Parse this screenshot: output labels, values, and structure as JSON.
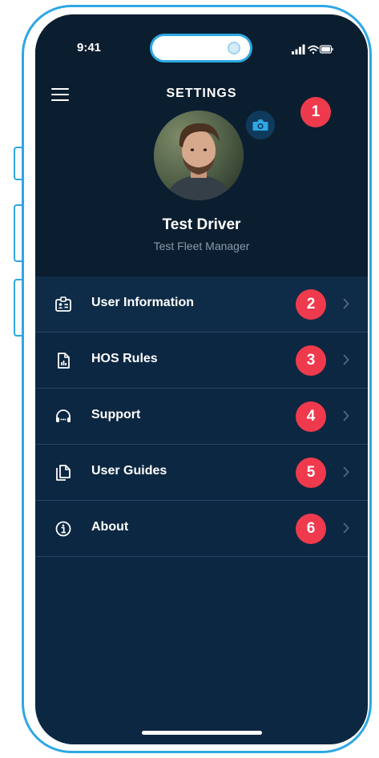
{
  "status_bar": {
    "time": "9:41"
  },
  "header": {
    "title": "SETTINGS"
  },
  "profile": {
    "name": "Test Driver",
    "role": "Test Fleet Manager",
    "badge": "1"
  },
  "menu": {
    "items": [
      {
        "label": "User Information",
        "badge": "2",
        "icon": "id-card-icon"
      },
      {
        "label": "HOS Rules",
        "badge": "3",
        "icon": "document-chart-icon"
      },
      {
        "label": "Support",
        "badge": "4",
        "icon": "headset-icon"
      },
      {
        "label": "User Guides",
        "badge": "5",
        "icon": "copy-document-icon"
      },
      {
        "label": "About",
        "badge": "6",
        "icon": "info-icon"
      }
    ]
  },
  "colors": {
    "accent": "#2ea7e3",
    "badge": "#ef3a4d",
    "background": "#0c2741",
    "header_background": "#0b1e30"
  }
}
